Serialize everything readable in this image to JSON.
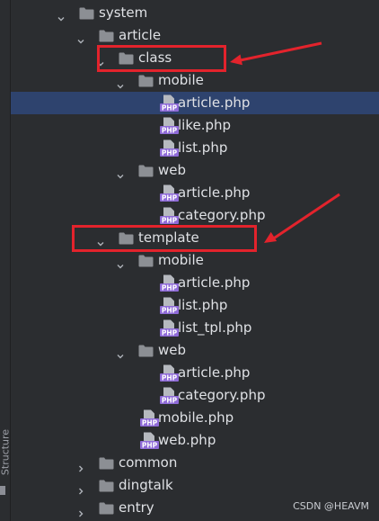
{
  "side_panel": {
    "label": "Structure"
  },
  "tree": [
    {
      "label": "system",
      "kind": "folder",
      "depth": 0,
      "expanded": true
    },
    {
      "label": "article",
      "kind": "folder",
      "depth": 1,
      "expanded": true
    },
    {
      "label": "class",
      "kind": "folder",
      "depth": 2,
      "expanded": true
    },
    {
      "label": "mobile",
      "kind": "folder",
      "depth": 3,
      "expanded": true
    },
    {
      "label": "article.php",
      "kind": "php",
      "depth": 4,
      "selected": true
    },
    {
      "label": "like.php",
      "kind": "php",
      "depth": 4
    },
    {
      "label": "list.php",
      "kind": "php",
      "depth": 4
    },
    {
      "label": "web",
      "kind": "folder",
      "depth": 3,
      "expanded": true
    },
    {
      "label": "article.php",
      "kind": "php",
      "depth": 4
    },
    {
      "label": "category.php",
      "kind": "php",
      "depth": 4
    },
    {
      "label": "template",
      "kind": "folder",
      "depth": 2,
      "expanded": true
    },
    {
      "label": "mobile",
      "kind": "folder",
      "depth": 3,
      "expanded": true
    },
    {
      "label": "article.php",
      "kind": "php",
      "depth": 4
    },
    {
      "label": "list.php",
      "kind": "php",
      "depth": 4
    },
    {
      "label": "list_tpl.php",
      "kind": "php",
      "depth": 4
    },
    {
      "label": "web",
      "kind": "folder",
      "depth": 3,
      "expanded": true
    },
    {
      "label": "article.php",
      "kind": "php",
      "depth": 4
    },
    {
      "label": "category.php",
      "kind": "php",
      "depth": 4
    },
    {
      "label": "mobile.php",
      "kind": "php",
      "depth": 3
    },
    {
      "label": "web.php",
      "kind": "php",
      "depth": 3
    },
    {
      "label": "common",
      "kind": "folder",
      "depth": 1,
      "expanded": false
    },
    {
      "label": "dingtalk",
      "kind": "folder",
      "depth": 1,
      "expanded": false
    },
    {
      "label": "entry",
      "kind": "folder",
      "depth": 1,
      "expanded": false
    }
  ],
  "annotations": [
    {
      "target": "class"
    },
    {
      "target": "template"
    }
  ],
  "colors": {
    "background": "#2b2d30",
    "text": "#dfe1e5",
    "folder": "#8c8f94",
    "php_badge": "#8f6bd8",
    "selection": "#2e436e",
    "annotation": "#e3232c"
  },
  "watermark": "CSDN @HEAVM"
}
